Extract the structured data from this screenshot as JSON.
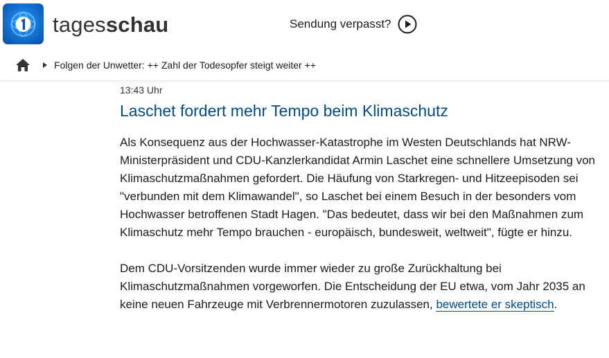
{
  "header": {
    "brand_part1": "tages",
    "brand_part2": "schau",
    "missed_label": "Sendung verpasst?",
    "logo_icon": "ard-one-logo-icon",
    "play_icon": "play-circle-icon",
    "brand_color": "#1476d8"
  },
  "breadcrumb": {
    "home_icon": "home-icon",
    "arrow_icon": "chevron-right-icon",
    "link_text": "Folgen der Unwetter: ++ Zahl der Todesopfer steigt weiter ++"
  },
  "article": {
    "time": "13:43 Uhr",
    "headline": "Laschet fordert mehr Tempo beim Klimaschutz",
    "paragraph1": "Als Konsequenz aus der Hochwasser-Katastrophe im Westen Deutschlands hat NRW-Ministerpräsident und CDU-Kanzlerkandidat Armin Laschet eine schnellere Umsetzung von Klimaschutzmaßnahmen gefordert. Die Häufung von Starkregen- und Hitzeepisoden sei \"verbunden mit dem Klimawandel\", so Laschet bei einem Besuch in der besonders vom Hochwasser betroffenen Stadt Hagen. \"Das bedeutet, dass wir bei den Maßnahmen zum Klimaschutz mehr Tempo brauchen - europäisch, bundesweit, weltweit\", fügte er hinzu.",
    "paragraph2_text": "Dem CDU-Vorsitzenden wurde immer wieder zu große Zurückhaltung bei Klimaschutzmaßnahmen vorgeworfen. Die Entscheidung der EU etwa, vom Jahr 2035 an keine neuen Fahrzeuge mit Verbrennermotoren zuzulassen, ",
    "paragraph2_link": "bewertete er skeptisch",
    "paragraph2_end": ".",
    "headline_color": "#004b86"
  }
}
